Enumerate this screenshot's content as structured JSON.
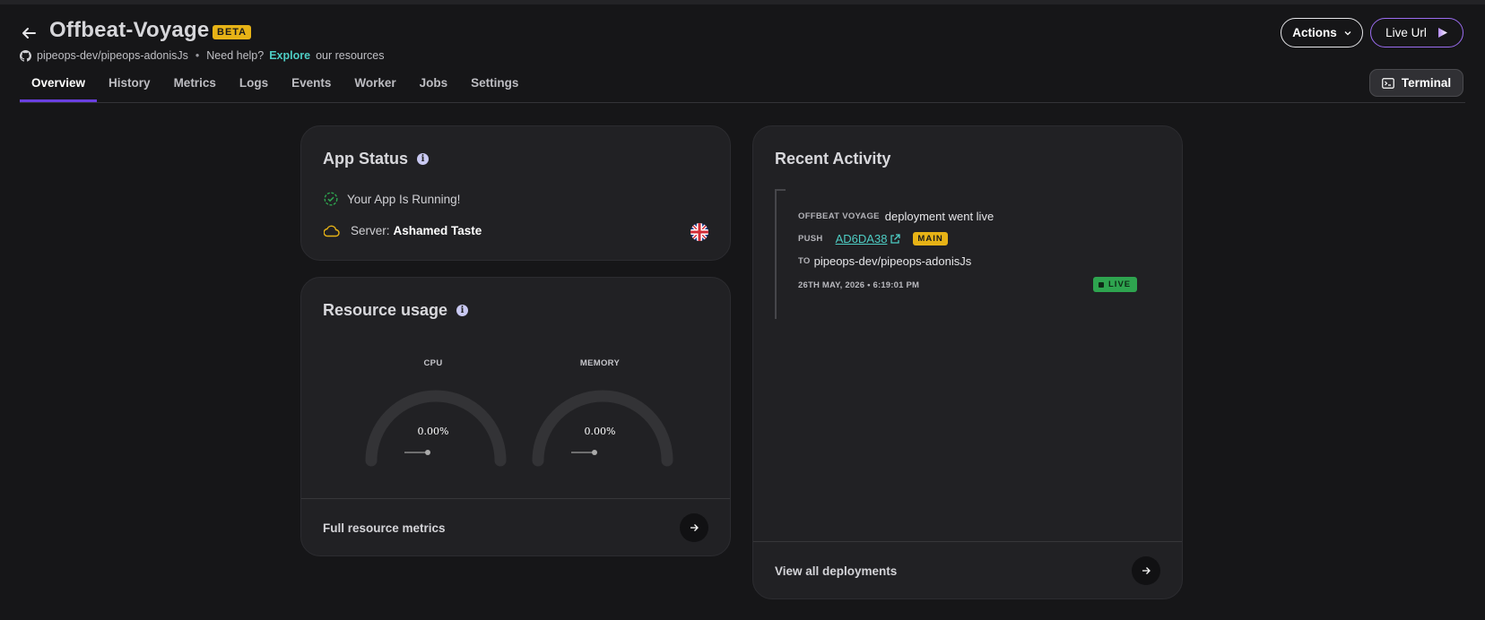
{
  "header": {
    "title": "Offbeat-Voyage",
    "beta_label": "BETA",
    "repo": "pipeops-dev/pipeops-adonisJs",
    "separator": "•",
    "help_prefix": "Need help?",
    "help_link": "Explore",
    "help_suffix": "our resources",
    "actions_label": "Actions",
    "live_url_label": "Live Url",
    "terminal_label": "Terminal"
  },
  "tabs": [
    {
      "label": "Overview",
      "active": true
    },
    {
      "label": "History"
    },
    {
      "label": "Metrics"
    },
    {
      "label": "Logs"
    },
    {
      "label": "Events"
    },
    {
      "label": "Worker"
    },
    {
      "label": "Jobs"
    },
    {
      "label": "Settings"
    }
  ],
  "app_status": {
    "title": "App Status",
    "running_text": "Your App Is Running!",
    "server_label": "Server:",
    "server_name": "Ashamed Taste"
  },
  "resource_usage": {
    "title": "Resource usage",
    "cpu": {
      "label": "CPU",
      "value": "0.00%",
      "fraction": 0
    },
    "memory": {
      "label": "MEMORY",
      "value": "0.00%",
      "fraction": 0
    },
    "footer_link": "Full resource metrics"
  },
  "recent_activity": {
    "title": "Recent Activity",
    "item": {
      "app_name": "OFFBEAT VOYAGE",
      "event": "deployment went live",
      "push_label": "PUSH",
      "commit": "AD6DA38",
      "branch": "MAIN",
      "to_label": "TO",
      "repo": "pipeops-dev/pipeops-adonisJs",
      "timestamp": "26TH MAY, 2026 • 6:19:01 PM",
      "status": "LIVE"
    },
    "footer_link": "View all deployments"
  },
  "colors": {
    "background": "#161618",
    "card": "#212124",
    "accent_teal": "#4ecdc4",
    "beta_yellow": "#e7b316",
    "live_green": "#2ea44f",
    "tab_indicator": "#6a3fe0"
  }
}
